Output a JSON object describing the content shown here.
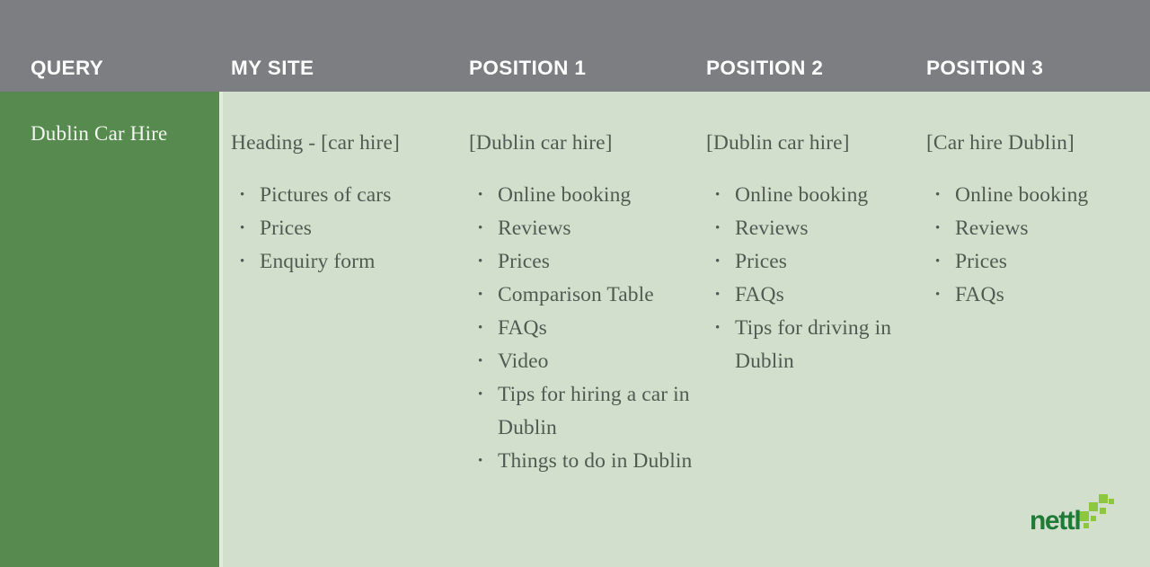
{
  "colors": {
    "header_bar": "#7c7e81",
    "query_column": "#568a4e",
    "body_background": "#d3dfcd",
    "body_text": "#4f5b51",
    "header_text": "#ffffff",
    "logo_dark_green": "#1e7a34",
    "logo_light_green": "#8dc63f"
  },
  "header": {
    "query": "QUERY",
    "my_site": "MY SITE",
    "position_1": "POSITION 1",
    "position_2": "POSITION 2",
    "position_3": "POSITION 3"
  },
  "query": {
    "label": "Dublin Car Hire"
  },
  "columns": {
    "my_site": {
      "title": "Heading - [car hire]",
      "items": [
        "Pictures of cars",
        "Prices",
        "Enquiry form"
      ]
    },
    "position_1": {
      "title": "[Dublin car hire]",
      "items": [
        "Online booking",
        "Reviews",
        "Prices",
        "Comparison Table",
        "FAQs",
        "Video",
        "Tips for hiring a car in Dublin",
        "Things to do in Dublin"
      ]
    },
    "position_2": {
      "title": "[Dublin car hire]",
      "items": [
        "Online booking",
        "Reviews",
        "Prices",
        "FAQs",
        "Tips for driving in Dublin"
      ]
    },
    "position_3": {
      "title": "[Car hire Dublin]",
      "items": [
        "Online booking",
        "Reviews",
        "Prices",
        "FAQs"
      ]
    }
  },
  "logo": {
    "wordmark": "nettl"
  }
}
